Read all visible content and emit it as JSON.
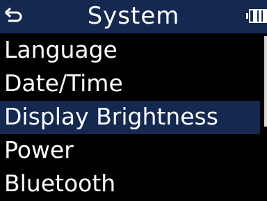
{
  "header": {
    "title": "System",
    "back_icon": "return-arrow-icon",
    "battery_icon": "battery-icon",
    "battery_level": 0.75
  },
  "menu": {
    "items": [
      {
        "label": "Language",
        "selected": false
      },
      {
        "label": "Date/Time",
        "selected": false
      },
      {
        "label": "Display Brightness",
        "selected": true
      },
      {
        "label": "Power",
        "selected": false
      },
      {
        "label": "Bluetooth",
        "selected": false
      }
    ]
  },
  "colors": {
    "background": "#000000",
    "header": "#142850",
    "highlight": "#142850",
    "text": "#ffffff"
  }
}
